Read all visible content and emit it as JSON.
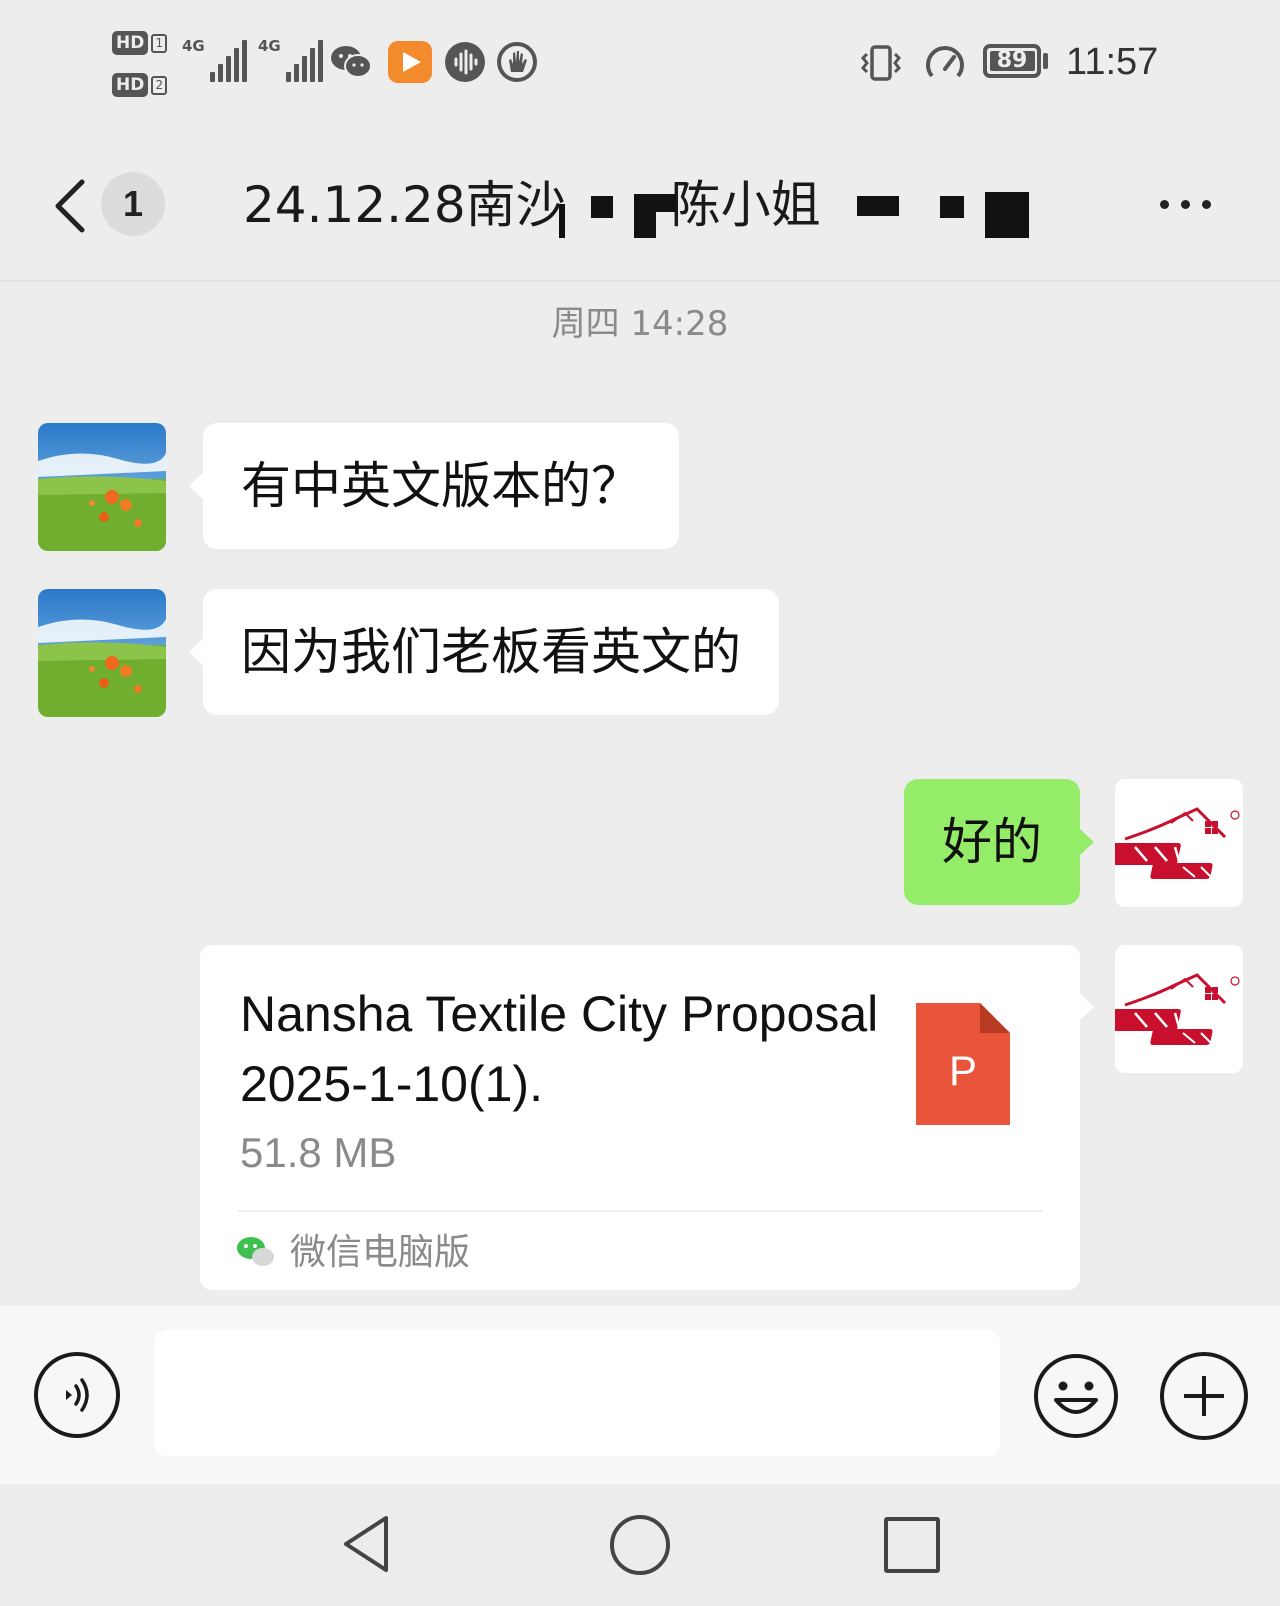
{
  "status_bar": {
    "sim1_label": "HD",
    "sim1_slot": "1",
    "sim2_label": "HD",
    "sim2_slot": "2",
    "net1": "4G",
    "net2": "4G",
    "battery_level": "89",
    "time": "11:57",
    "notification_icons": [
      "wechat-icon",
      "video-app-icon",
      "audio-app-icon",
      "hand-app-icon"
    ]
  },
  "header": {
    "unread_count": "1",
    "title_part1": "24.12.28南沙",
    "title_part2": "陈小姐"
  },
  "chat": {
    "timestamp": "周四 14:28",
    "messages": [
      {
        "side": "left",
        "text": "有中英文版本的？"
      },
      {
        "side": "left",
        "text": "因为我们老板看英文的"
      },
      {
        "side": "right",
        "text": "好的"
      }
    ],
    "file": {
      "name": "Nansha Textile City Proposal 2025-1-10(1).",
      "size": "51.8 MB",
      "icon_letter": "P",
      "source": "微信电脑版"
    }
  },
  "input": {
    "placeholder": ""
  },
  "colors": {
    "background": "#ededed",
    "outgoing_bubble": "#95ec69",
    "incoming_bubble": "#ffffff",
    "ppt_icon": "#e8553a",
    "video_app": "#f38b2c",
    "brand_red": "#c8102e"
  }
}
